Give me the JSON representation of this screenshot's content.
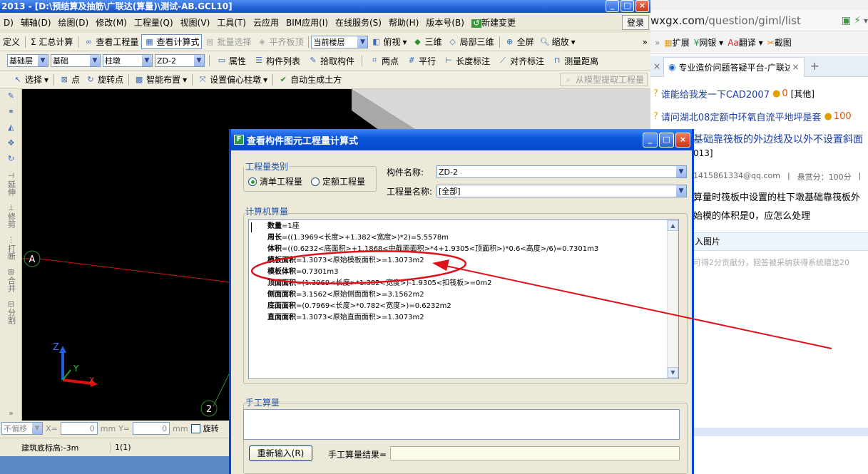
{
  "app": {
    "title": "2013 - [D:\\预结算及抽筋\\广联达(算量)\\测试-AB.GCL10]",
    "menu": [
      "辅轴(D)",
      "绘图(D)",
      "修改(M)",
      "工程量(Q)",
      "视图(V)",
      "工具(T)",
      "云应用",
      "BIM应用(I)",
      "在线服务(S)",
      "帮助(H)",
      "版本号(B)",
      "新建变更"
    ],
    "menu_prefix": "D)",
    "login_label": "登录"
  },
  "toolbar1": {
    "items": [
      "定义",
      "Σ 汇总计算",
      "查看工程量",
      "查看计算式",
      "批量选择",
      "平齐板顶",
      "三维",
      "局部三维",
      "全屏",
      "缩放"
    ],
    "floor_select": "当前楼层",
    "view_select": "俯视",
    "more": "»"
  },
  "toolbar2": {
    "layer": "基础层",
    "category": "基础",
    "type": "柱墩",
    "component": "ZD-2",
    "items": [
      "属性",
      "构件列表",
      "拾取构件",
      "两点",
      "平行",
      "长度标注",
      "对齐标注",
      "测量距离"
    ]
  },
  "toolbar3": {
    "items": [
      "选择",
      "点",
      "旋转点",
      "智能布置",
      "设置偏心柱墩",
      "自动生成土方"
    ],
    "extract": "从模型提取工程量"
  },
  "leftstrip": {
    "items": [
      "延伸",
      "修剪",
      "打断",
      "合并",
      "分割"
    ],
    "more": "»"
  },
  "canvas": {
    "label_a": "A",
    "label_2": "2",
    "axis_z": "Z",
    "axis_y": "Y",
    "axis_x": "X"
  },
  "coordbar": {
    "mode": "不偏移",
    "x_label": "X=",
    "x_value": "0",
    "unit1": "mm",
    "y_label": "Y=",
    "y_value": "0",
    "unit2": "mm",
    "rotate": "旋转"
  },
  "statusbar": {
    "elevation": "建筑底标高:-3m",
    "count": "1(1)"
  },
  "browser": {
    "url_host": "wxgx.com",
    "url_path": "/question/giml/list",
    "bookmarks": [
      "扩展",
      "网银",
      "翻译",
      "截图"
    ],
    "more": "»",
    "tab_title": "专业造价问题答疑平台-广联达",
    "tab_close": "×",
    "tab_new": "+",
    "questions": [
      {
        "title": "谁能给我发一下CAD2007",
        "count": "0",
        "tag": "[其他]"
      },
      {
        "title": "请问湖北08定额中环氧自流平地坪是套",
        "count": "100",
        "tag": ""
      }
    ],
    "question_title": "基础靠筏板的外边线及以外不设置斜面",
    "question_year": "013]",
    "asker": "1415861334@qq.com",
    "reward": "悬赏分：100分",
    "body_line1": "算量时筏板中设置的柱下墩基础靠筏板外",
    "body_line2": "始模的体积是0，应怎么处理",
    "attach": "入图片",
    "hint": "可得2分贡献分，回答被采纳获得系统赠送20"
  },
  "dialog": {
    "title": "查看构件图元工程量计算式",
    "group_type": "工程量类别",
    "radio1": "清单工程量",
    "radio2": "定额工程量",
    "component_label": "构件名称:",
    "component_value": "ZD-2",
    "qty_label": "工程量名称:",
    "qty_value": "[全部]",
    "group_calc": "计算机算量",
    "lines": [
      {
        "key": "数量",
        "val": "=1座"
      },
      {
        "key": "周长",
        "val": "=((1.3969<长度>+1.382<宽度>)*2)=5.5578m"
      },
      {
        "key": "体积",
        "val": "=((0.6232<底面积>+1.1868<中截面面积>*4+1.9305<顶面积>)*0.6<高度>/6)=0.7301m3"
      },
      {
        "key": "模板面积",
        "val": "=1.3073<原始模板面积>=1.3073m2"
      },
      {
        "key": "模板体积",
        "val": "=0.7301m3"
      },
      {
        "key": "顶面面积",
        "val": "=(1.3969<长度>*1.382<宽度>)-1.9305<扣筏板>=0m2"
      },
      {
        "key": "侧面面积",
        "val": "=3.1562<原始侧面面积>=3.1562m2"
      },
      {
        "key": "底面面积",
        "val": "=(0.7969<长度>*0.782<宽度>)=0.6232m2"
      },
      {
        "key": "直面面积",
        "val": "=1.3073<原始直面面积>=1.3073m2"
      }
    ],
    "group_manual": "手工算量",
    "reinput": "重新输入(R)",
    "manual_result_label": "手工算量结果="
  },
  "colors": {
    "annotation_red": "#e0101a",
    "dialog_blue": "#0a46d4",
    "canvas_bg": "#000000"
  }
}
